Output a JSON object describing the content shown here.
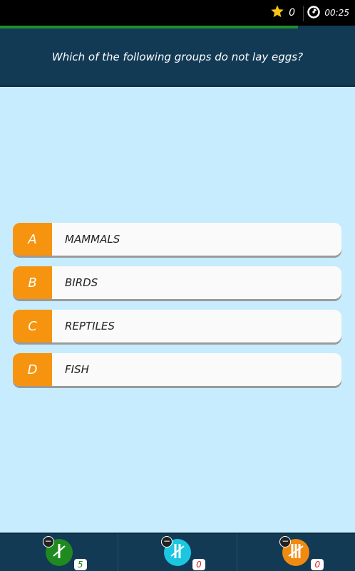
{
  "header": {
    "score": "0",
    "timer": "00:25",
    "progress": 0.84
  },
  "question": {
    "text": "Which of the following groups do not lay eggs?"
  },
  "answers": [
    {
      "letter": "A",
      "label": "MAMMALS"
    },
    {
      "letter": "B",
      "label": "BIRDS"
    },
    {
      "letter": "C",
      "label": "REPTILES"
    },
    {
      "letter": "D",
      "label": "FISH"
    }
  ],
  "lifelines": [
    {
      "count": "5",
      "color": "#1f8a1f",
      "count_color": "#1f8a1f",
      "icon": "tally-one-icon"
    },
    {
      "count": "0",
      "color": "#1cc6e0",
      "count_color": "#d42020",
      "icon": "tally-two-icon"
    },
    {
      "count": "0",
      "color": "#f08a10",
      "count_color": "#d42020",
      "icon": "tally-three-icon"
    }
  ],
  "colors": {
    "background": "#c6ecfd",
    "panel": "#123a55",
    "accent": "#f6940f",
    "progress": "#1e8e2c"
  }
}
